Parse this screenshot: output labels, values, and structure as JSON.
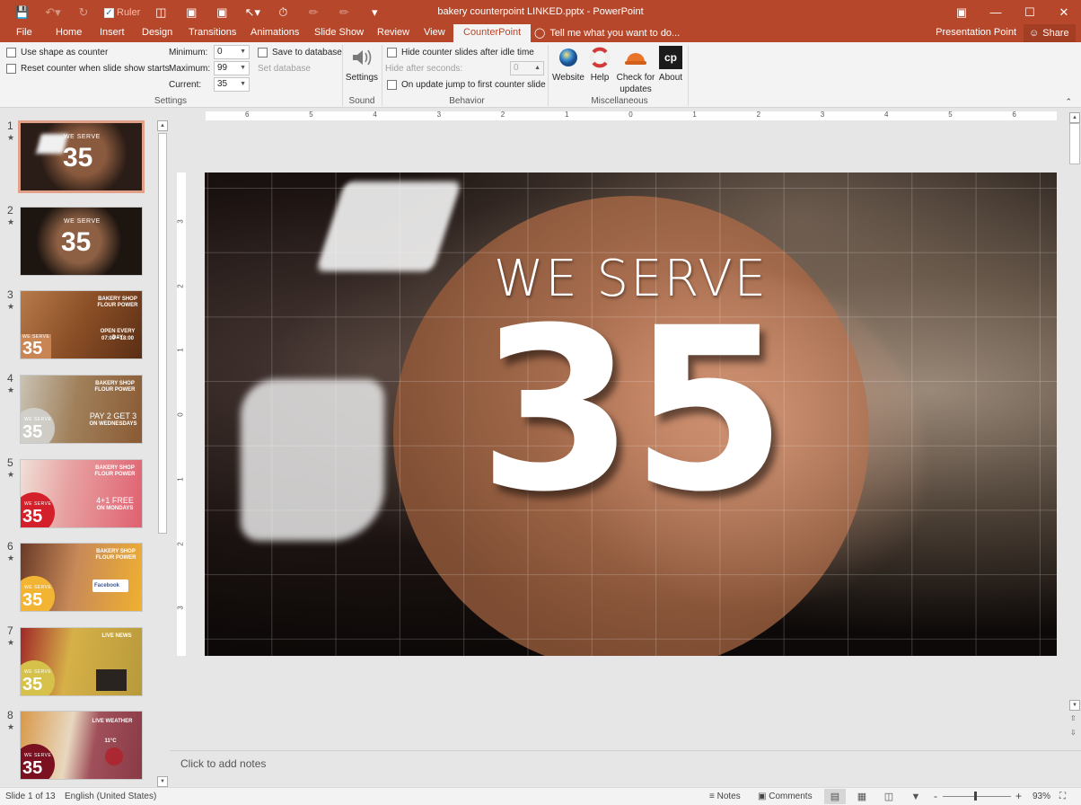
{
  "window": {
    "title": "bakery counterpoint LINKED.pptx - PowerPoint",
    "controls": [
      "ribbon-display-icon",
      "minimize-icon",
      "maximize-icon",
      "close-icon"
    ]
  },
  "quick_access": {
    "save_icon": "save-icon",
    "undo_icon": "undo-icon",
    "redo_icon": "redo-icon",
    "ruler_label": "Ruler",
    "ruler_checked": true
  },
  "tabs": [
    {
      "label": "File"
    },
    {
      "label": "Home"
    },
    {
      "label": "Insert"
    },
    {
      "label": "Design"
    },
    {
      "label": "Transitions"
    },
    {
      "label": "Animations"
    },
    {
      "label": "Slide Show"
    },
    {
      "label": "Review"
    },
    {
      "label": "View"
    },
    {
      "label": "CounterPoint",
      "active": true
    }
  ],
  "tell_me": "Tell me what you want to do...",
  "presentation_point": "Presentation Point",
  "share": "Share",
  "ribbon": {
    "settings": {
      "use_shape": "Use shape as counter",
      "reset_counter": "Reset counter when slide show starts",
      "minimum_label": "Minimum:",
      "minimum_value": "0",
      "maximum_label": "Maximum:",
      "maximum_value": "99",
      "current_label": "Current:",
      "current_value": "35",
      "save_db": "Save to database",
      "set_db": "Set database",
      "group_label": "Settings"
    },
    "sound": {
      "button": "Settings",
      "group_label": "Sound"
    },
    "behavior": {
      "hide_idle": "Hide counter slides after idle time",
      "hide_after_label": "Hide after seconds:",
      "hide_after_value": "0",
      "jump_first": "On update jump to first counter slide",
      "group_label": "Behavior"
    },
    "misc": {
      "website": "Website",
      "help": "Help",
      "check_updates_1": "Check for",
      "check_updates_2": "updates",
      "about": "About",
      "about_logo": "cp",
      "group_label": "Miscellaneous"
    }
  },
  "ruler": {
    "h_ticks": [
      "6",
      "5",
      "4",
      "3",
      "2",
      "1",
      "0",
      "1",
      "2",
      "3",
      "4",
      "5",
      "6"
    ],
    "v_ticks": [
      "3",
      "2",
      "1",
      "0",
      "1",
      "2",
      "3"
    ]
  },
  "thumbnails": [
    {
      "num": "1",
      "ws": "WE SERVE",
      "count": "35",
      "selected": true
    },
    {
      "num": "2",
      "ws": "WE SERVE",
      "count": "35"
    },
    {
      "num": "3",
      "ws": "WE SERVE",
      "count": "35",
      "title": "BAKERY SHOP FLOUR POWER",
      "line": "OPEN EVERY DAY",
      "line2": "07:00 - 18:00"
    },
    {
      "num": "4",
      "ws": "WE SERVE",
      "count": "35",
      "title": "BAKERY SHOP FLOUR POWER",
      "line": "PAY 2 GET 3",
      "line2": "ON WEDNESDAYS"
    },
    {
      "num": "5",
      "ws": "WE SERVE",
      "count": "35",
      "title": "BAKERY SHOP FLOUR POWER",
      "line": "4+1 FREE",
      "line2": "ON MONDAYS"
    },
    {
      "num": "6",
      "ws": "WE SERVE",
      "count": "35",
      "title": "BAKERY SHOP FLOUR POWER",
      "line": "Facebook"
    },
    {
      "num": "7",
      "ws": "WE SERVE",
      "count": "35",
      "title": "LIVE NEWS"
    },
    {
      "num": "8",
      "ws": "WE SERVE",
      "count": "35",
      "title": "LIVE WEATHER",
      "line": "11°C"
    }
  ],
  "slide": {
    "heading": "WE SERVE",
    "counter": "35"
  },
  "notes_placeholder": "Click to add notes",
  "status": {
    "slide_info": "Slide 1 of 13",
    "language": "English (United States)",
    "notes": "Notes",
    "comments": "Comments",
    "zoom": "93%",
    "zoom_value_percent": 93
  }
}
